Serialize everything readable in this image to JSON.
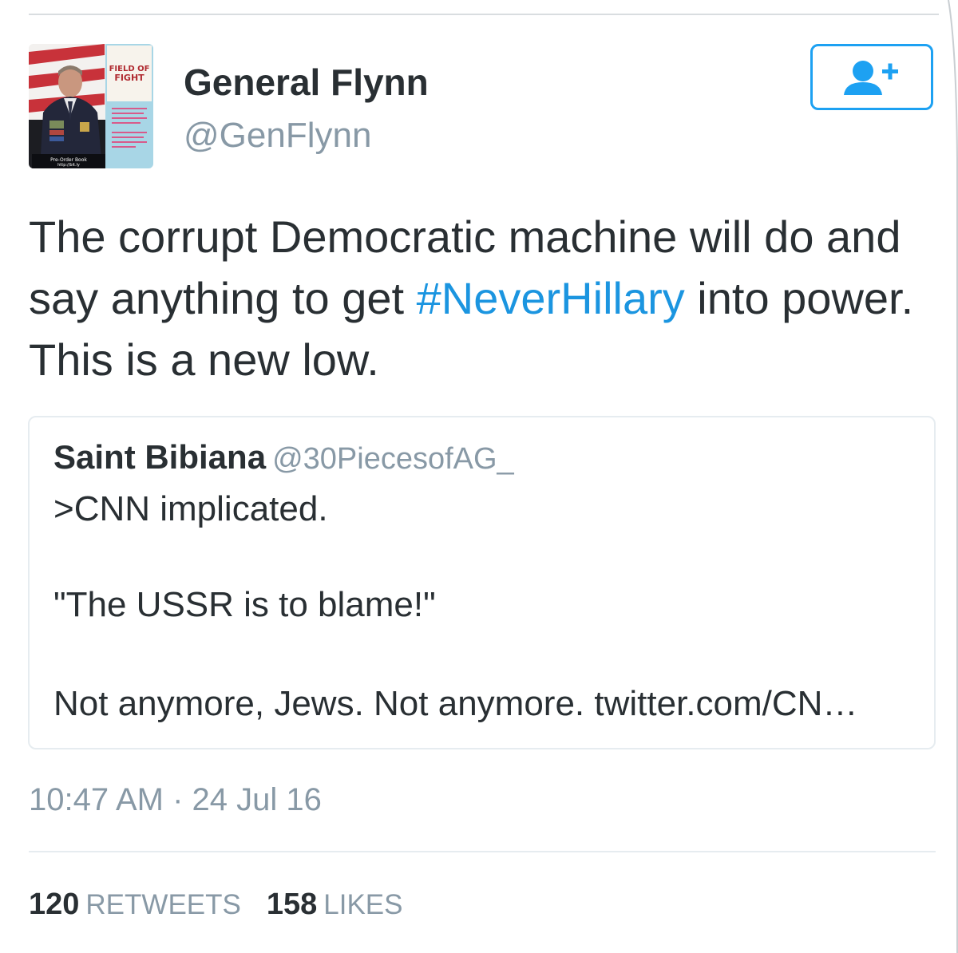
{
  "author": {
    "name": "General Flynn",
    "handle": "@GenFlynn",
    "avatar_book_title_line1": "FIELD OF",
    "avatar_book_title_line2": "FIGHT"
  },
  "follow_button": {
    "icon": "follow-user-plus-icon"
  },
  "tweet": {
    "text_before": "The corrupt Democratic machine will do and say anything to get ",
    "hashtag": "#NeverHillary",
    "text_after": " into power. This is a new low."
  },
  "quoted_tweet": {
    "name": "Saint Bibiana",
    "handle": "@30PiecesofAG_",
    "line1": ">CNN implicated.",
    "line2": "\"The USSR is to blame!\"",
    "line3": "Not anymore, Jews. Not anymore. twitter.com/CN…"
  },
  "timestamp": "10:47 AM · 24 Jul 16",
  "stats": {
    "retweets_count": "120",
    "retweets_label": "RETWEETS",
    "likes_count": "158",
    "likes_label": "LIKES"
  },
  "colors": {
    "accent": "#1da1f2",
    "hashtag": "#1b95e0",
    "text": "#292f33",
    "secondary_text": "#8899a6",
    "border": "#e6ecf0"
  }
}
